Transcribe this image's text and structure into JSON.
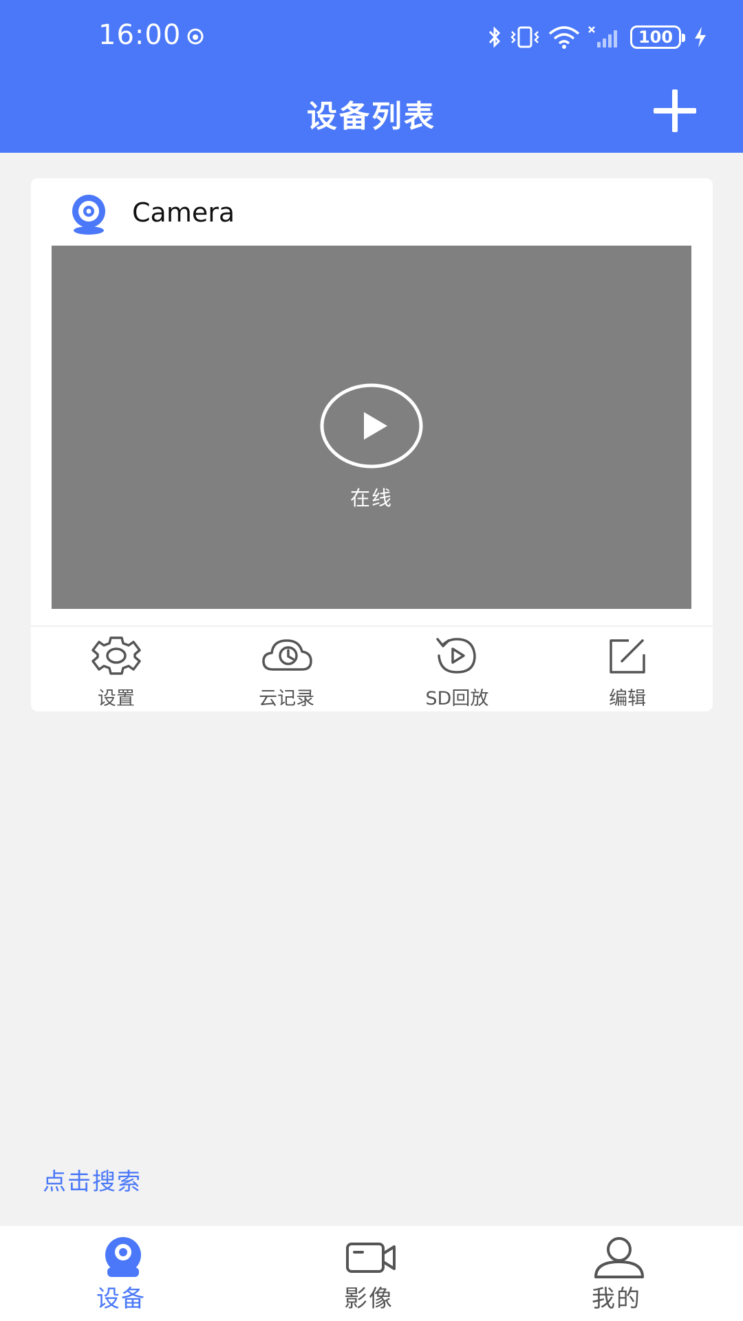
{
  "status_bar": {
    "time": "16:00",
    "battery": "100"
  },
  "header": {
    "title": "设备列表",
    "add_icon": "plus-icon"
  },
  "device": {
    "name": "Camera",
    "status": "在线",
    "actions": [
      {
        "label": "设置",
        "icon": "gear-icon"
      },
      {
        "label": "云记录",
        "icon": "cloud-clock-icon"
      },
      {
        "label": "SD回放",
        "icon": "replay-icon"
      },
      {
        "label": "编辑",
        "icon": "edit-icon"
      }
    ]
  },
  "search_link": "点击搜索",
  "tab_bar": {
    "tabs": [
      {
        "label": "设备",
        "icon": "camera-icon",
        "active": true
      },
      {
        "label": "影像",
        "icon": "video-icon",
        "active": false
      },
      {
        "label": "我的",
        "icon": "person-icon",
        "active": false
      }
    ]
  },
  "colors": {
    "primary": "#4a78f8",
    "preview_bg": "#808080",
    "page_bg": "#f2f2f2"
  }
}
